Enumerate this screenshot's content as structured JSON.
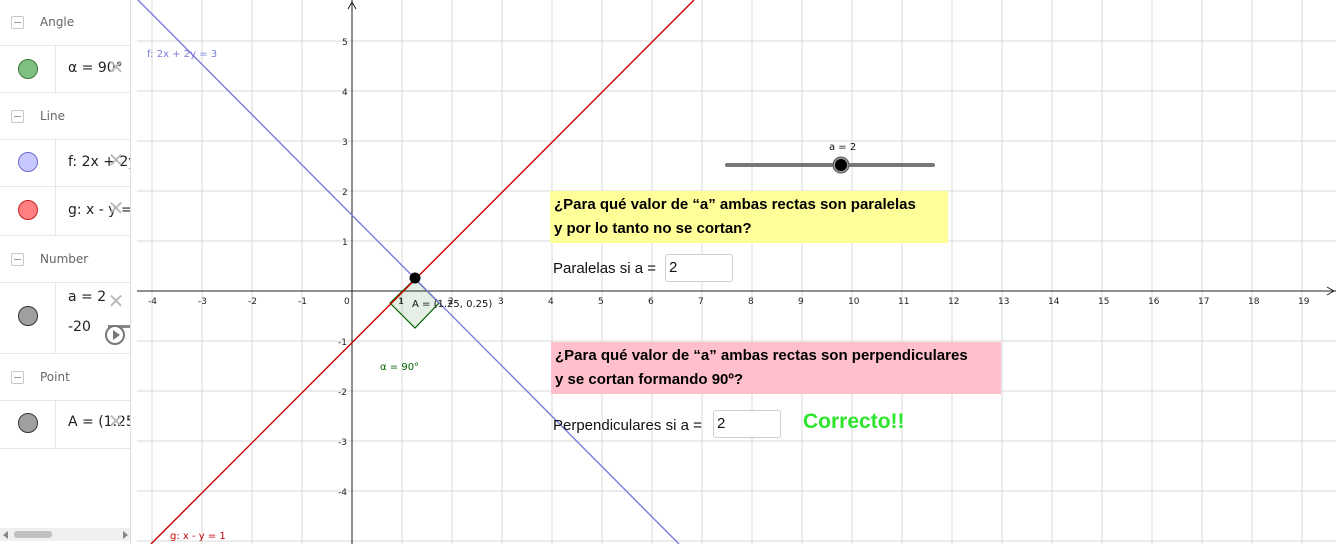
{
  "algebra": {
    "groups": {
      "angle": "Angle",
      "line": "Line",
      "number": "Number",
      "point": "Point"
    },
    "items": {
      "alpha": "α = 90°",
      "f": "f: 2x + 2y",
      "g": "g: x - y =",
      "a": "a = 2",
      "a_min": "-20",
      "A": "A = (1.25,"
    },
    "colors": {
      "alpha": "#7fbf7f",
      "f": "#c8c8ff",
      "g": "#ff8080",
      "a": "#a0a0a0",
      "A": "#a0a0a0"
    }
  },
  "graphics": {
    "x_ticks": [
      "-4",
      "-3",
      "-2",
      "-1",
      "0",
      "1",
      "2",
      "3",
      "4",
      "5",
      "6",
      "7",
      "8",
      "9",
      "10",
      "11",
      "12",
      "13",
      "14",
      "15",
      "16",
      "17",
      "18",
      "19"
    ],
    "y_ticks": [
      "5",
      "4",
      "3",
      "2",
      "1",
      "-1",
      "-2",
      "-3",
      "-4"
    ],
    "line_f_label": "f: 2x + 2y = 3",
    "line_g_label": "g: x - y = 1",
    "point_label": "A = (1.25, 0.25)",
    "angle_label": "α = 90°",
    "angle_inner": "1",
    "slider_label": "a = 2",
    "slider_value": 2,
    "colors": {
      "f": "#7b7bdc",
      "g": "#cc0000",
      "grid": "#d4d4d4",
      "angle": "#006100"
    }
  },
  "questions": {
    "parallel": {
      "line1": "¿Para qué valor de “a” ambas rectas son paralelas",
      "line2": "y por lo tanto no se cortan?",
      "label": "Paralelas si a =",
      "value": "2"
    },
    "perpendicular": {
      "line1": "¿Para qué valor de “a” ambas rectas son perpendiculares",
      "line2": "y se cortan formando 90º?",
      "label": "Perpendiculares si a =",
      "value": "2",
      "feedback": "Correcto!!"
    }
  }
}
